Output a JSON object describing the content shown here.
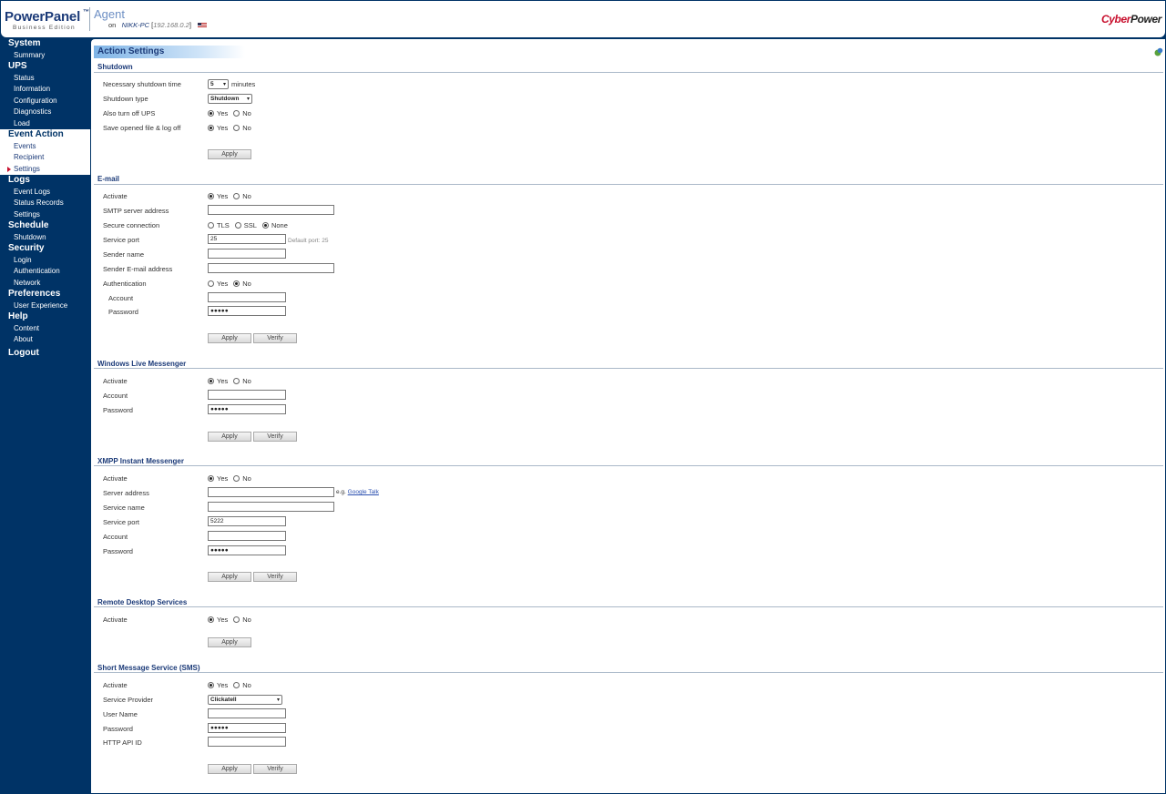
{
  "header": {
    "logo_main": "PowerPanel",
    "logo_tm": "™",
    "logo_sub": "Business Edition",
    "agent": "Agent",
    "on": "on",
    "host": "NIKK-PC",
    "ip": "192.168.0.2",
    "brand_red": "Cyber",
    "brand_dark": "Power"
  },
  "sidebar": {
    "system": "System",
    "summary": "Summary",
    "ups": "UPS",
    "status": "Status",
    "information": "Information",
    "configuration": "Configuration",
    "diagnostics": "Diagnostics",
    "load": "Load",
    "event_action": "Event Action",
    "events": "Events",
    "recipient": "Recipient",
    "settings": "Settings",
    "logs": "Logs",
    "event_logs": "Event Logs",
    "status_records": "Status Records",
    "logs_settings": "Settings",
    "schedule": "Schedule",
    "shutdown": "Shutdown",
    "security": "Security",
    "login": "Login",
    "authentication": "Authentication",
    "network": "Network",
    "preferences": "Preferences",
    "user_experience": "User Experience",
    "help": "Help",
    "content": "Content",
    "about": "About",
    "logout": "Logout"
  },
  "page_title": "Action Settings",
  "common": {
    "yes": "Yes",
    "no": "No",
    "apply": "Apply",
    "verify": "Verify",
    "password_mask": "●●●●●"
  },
  "shutdown": {
    "title": "Shutdown",
    "time_label": "Necessary shutdown time",
    "time_value": "5",
    "time_unit": "minutes",
    "type_label": "Shutdown type",
    "type_value": "Shutdown",
    "turn_off_label": "Also turn off UPS",
    "save_label": "Save opened file & log off"
  },
  "email": {
    "title": "E-mail",
    "activate": "Activate",
    "smtp": "SMTP server address",
    "secure": "Secure connection",
    "tls": "TLS",
    "ssl": "SSL",
    "none": "None",
    "port_label": "Service port",
    "port_value": "25",
    "port_hint": "Default port: 25",
    "sender_name": "Sender name",
    "sender_email": "Sender E-mail address",
    "auth": "Authentication",
    "account": "Account",
    "password": "Password"
  },
  "wlm": {
    "title": "Windows Live Messenger",
    "activate": "Activate",
    "account": "Account",
    "password": "Password"
  },
  "xmpp": {
    "title": "XMPP Instant Messenger",
    "activate": "Activate",
    "server": "Server address",
    "eg": "e.g.",
    "google_talk": "Google Talk",
    "service_name": "Service name",
    "port_label": "Service port",
    "port_value": "5222",
    "account": "Account",
    "password": "Password"
  },
  "rds": {
    "title": "Remote Desktop Services",
    "activate": "Activate"
  },
  "sms": {
    "title": "Short Message Service (SMS)",
    "activate": "Activate",
    "provider_label": "Service Provider",
    "provider_value": "Clickatell",
    "user_name": "User Name",
    "password": "Password",
    "api_id": "HTTP API ID"
  }
}
